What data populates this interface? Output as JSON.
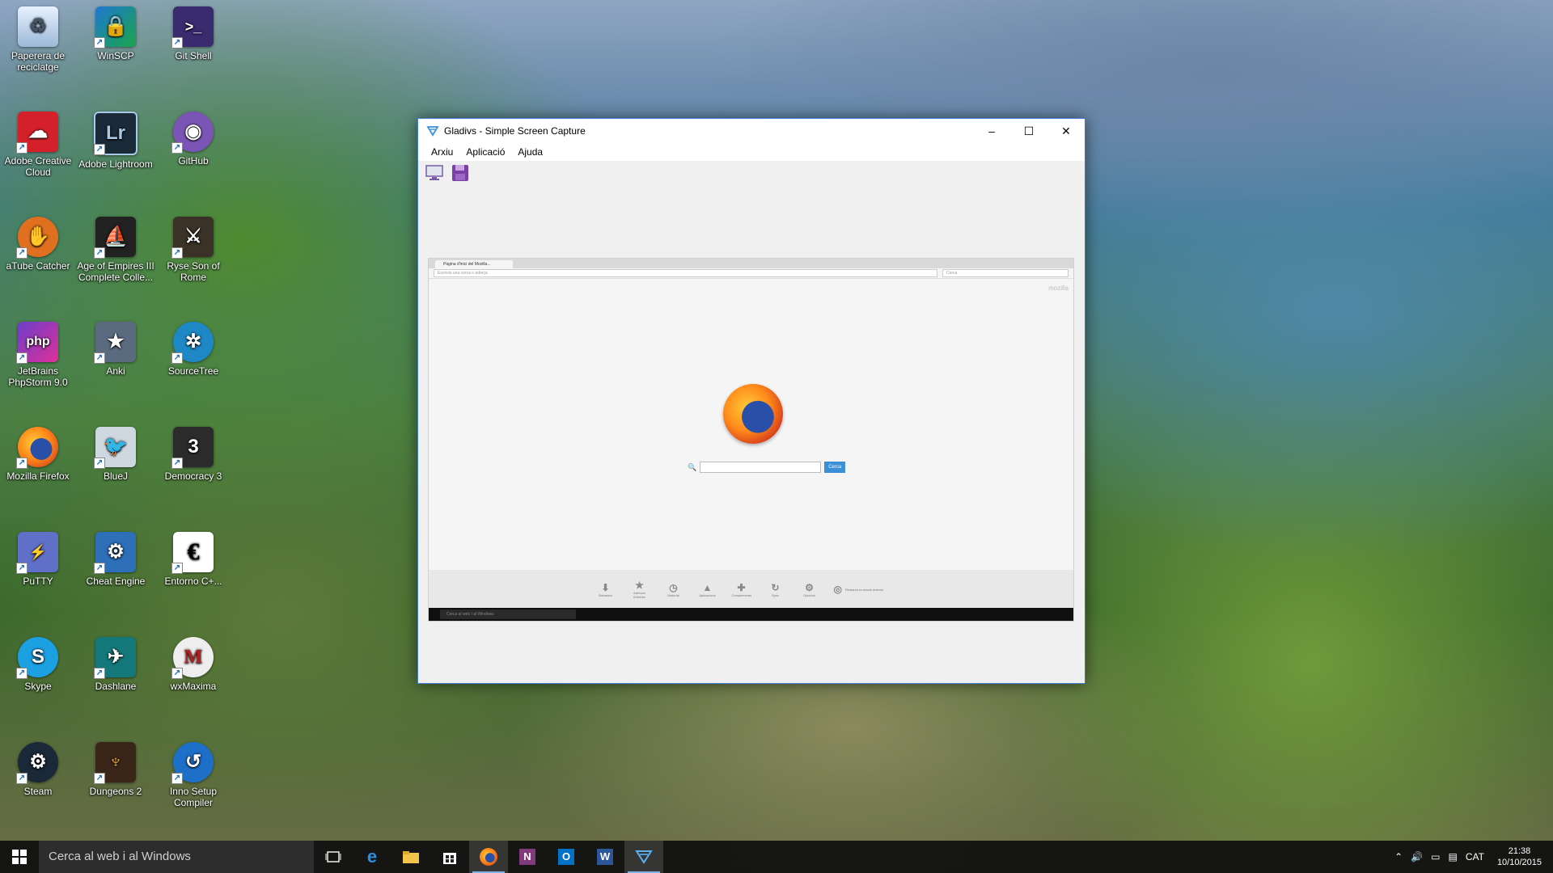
{
  "desktop": {
    "icons": [
      {
        "label": "Paperera de reciclatge"
      },
      {
        "label": "WinSCP"
      },
      {
        "label": "Git Shell"
      },
      {
        "label": "Adobe Creative Cloud"
      },
      {
        "label": "Adobe Lightroom"
      },
      {
        "label": "GitHub"
      },
      {
        "label": "aTube Catcher"
      },
      {
        "label": "Age of Empires III Complete Colle..."
      },
      {
        "label": "Ryse Son of Rome"
      },
      {
        "label": "JetBrains PhpStorm 9.0"
      },
      {
        "label": "Anki"
      },
      {
        "label": "SourceTree"
      },
      {
        "label": "Mozilla Firefox"
      },
      {
        "label": "BlueJ"
      },
      {
        "label": "Democracy 3"
      },
      {
        "label": "PuTTY"
      },
      {
        "label": "Cheat Engine"
      },
      {
        "label": "Entorno C+..."
      },
      {
        "label": "Skype"
      },
      {
        "label": "Dashlane"
      },
      {
        "label": "wxMaxima"
      },
      {
        "label": "Steam"
      },
      {
        "label": "Dungeons 2"
      },
      {
        "label": "Inno Setup Compiler"
      }
    ]
  },
  "window": {
    "title": "Gladivs - Simple Screen Capture",
    "controls": {
      "minimize": "–",
      "maximize": "☐",
      "close": "✕"
    },
    "menu": [
      "Arxiu",
      "Aplicació",
      "Ajuda"
    ],
    "toolbar": {
      "capture_icon": "monitor-icon",
      "save_icon": "floppy-icon"
    }
  },
  "capture": {
    "tab_title": "Pàgina d'inici del Mozilla...",
    "url_placeholder": "Escriviu una cerca o adreça",
    "search_placeholder": "Cerca",
    "brand": "mozilla",
    "search_button": "Cerca",
    "bottom_items": [
      "Baixades",
      "Adreces d'interès",
      "Historial",
      "Aplicacions",
      "Complements",
      "Sync",
      "Opcions"
    ],
    "restore_session": "Restaura la sessió anterior",
    "taskbar_search": "Cerca al web i al Windows"
  },
  "taskbar": {
    "search_placeholder": "Cerca al web i al Windows",
    "apps": [
      "task-view-icon",
      "edge-icon",
      "file-explorer-icon",
      "store-icon",
      "firefox-icon",
      "onenote-icon",
      "outlook-icon",
      "word-icon",
      "gladivs-icon"
    ],
    "language": "CAT",
    "time": "21:38",
    "date": "10/10/2015"
  },
  "colors": {
    "accent": "#3f7ed8",
    "taskbar": "#101010",
    "active_underline": "#7db3e8"
  }
}
